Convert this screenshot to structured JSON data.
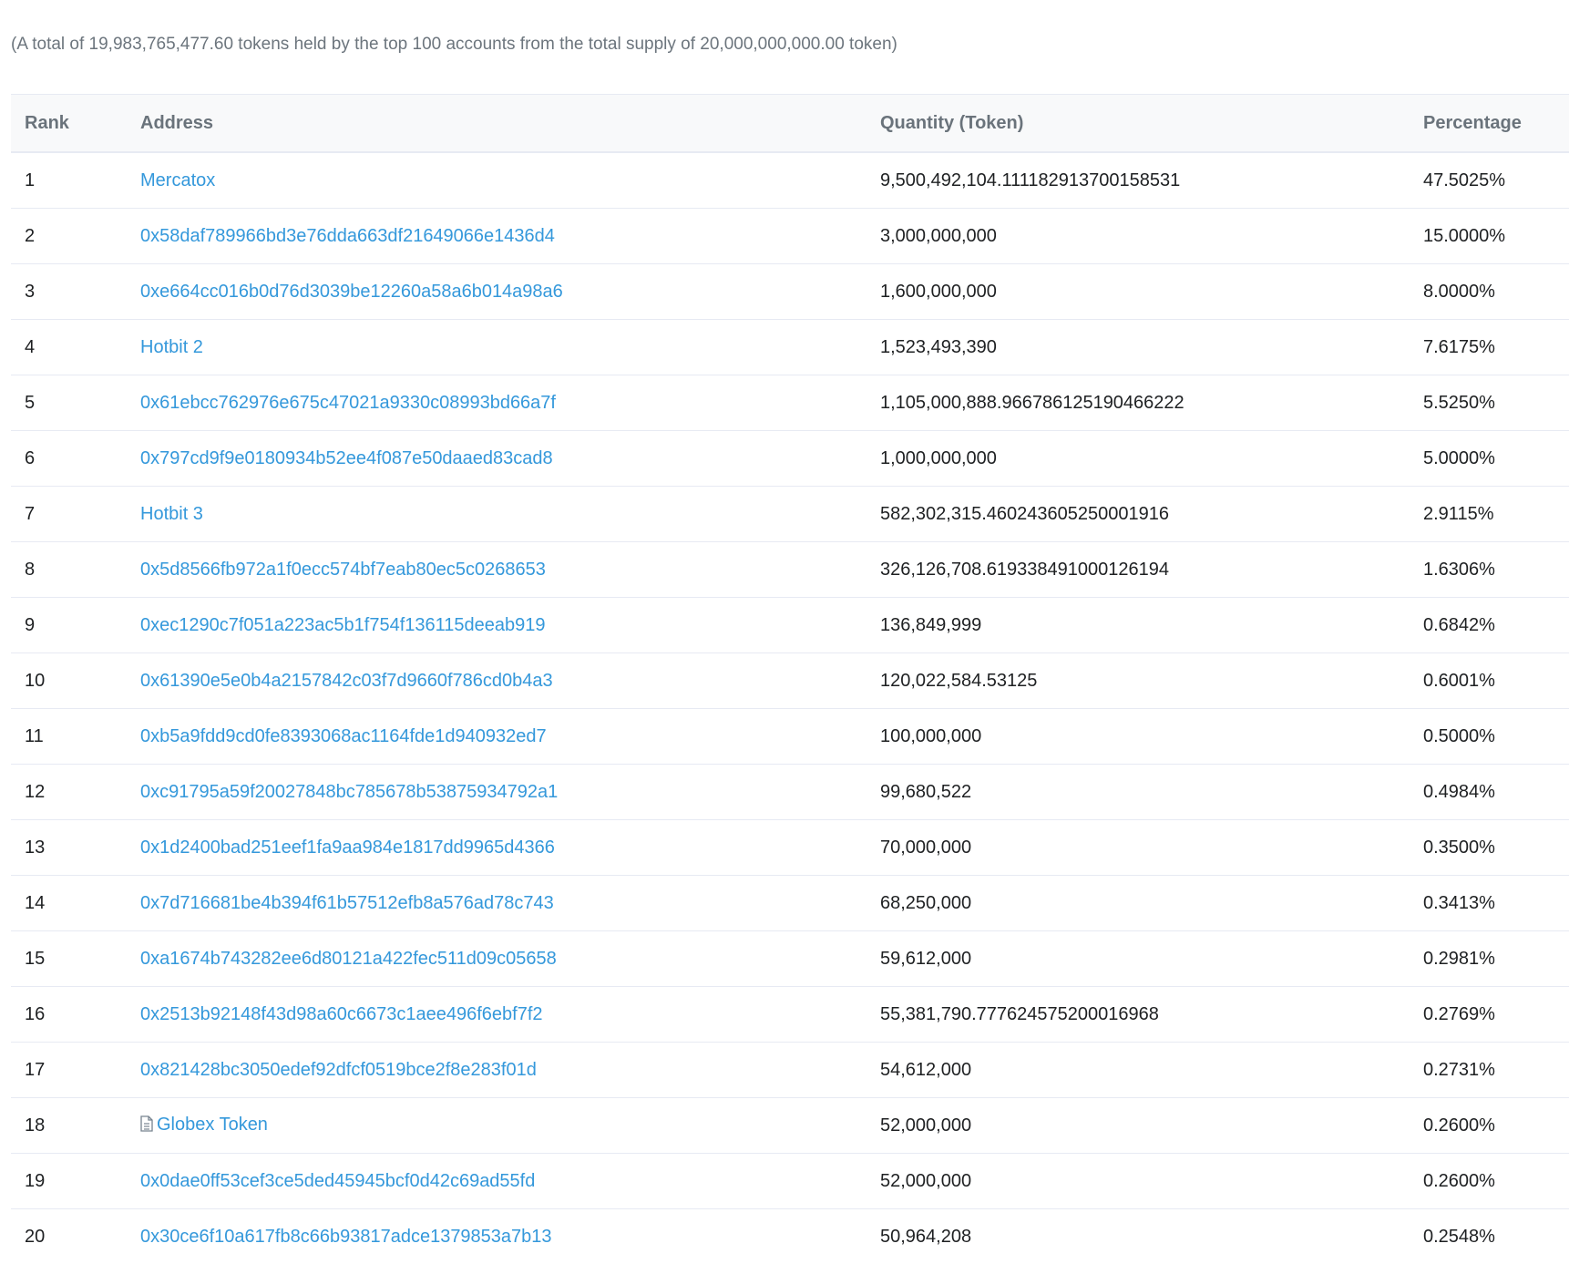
{
  "summary": "(A total of 19,983,765,477.60 tokens held by the top 100 accounts from the total supply of 20,000,000,000.00 token)",
  "table": {
    "headers": {
      "rank": "Rank",
      "address": "Address",
      "quantity": "Quantity (Token)",
      "percentage": "Percentage"
    },
    "rows": [
      {
        "rank": "1",
        "address": "Mercatox",
        "quantity": "9,500,492,104.111182913700158531",
        "percentage": "47.5025%",
        "icon": ""
      },
      {
        "rank": "2",
        "address": "0x58daf789966bd3e76dda663df21649066e1436d4",
        "quantity": "3,000,000,000",
        "percentage": "15.0000%",
        "icon": ""
      },
      {
        "rank": "3",
        "address": "0xe664cc016b0d76d3039be12260a58a6b014a98a6",
        "quantity": "1,600,000,000",
        "percentage": "8.0000%",
        "icon": ""
      },
      {
        "rank": "4",
        "address": "Hotbit 2",
        "quantity": "1,523,493,390",
        "percentage": "7.6175%",
        "icon": ""
      },
      {
        "rank": "5",
        "address": "0x61ebcc762976e675c47021a9330c08993bd66a7f",
        "quantity": "1,105,000,888.966786125190466222",
        "percentage": "5.5250%",
        "icon": ""
      },
      {
        "rank": "6",
        "address": "0x797cd9f9e0180934b52ee4f087e50daaed83cad8",
        "quantity": "1,000,000,000",
        "percentage": "5.0000%",
        "icon": ""
      },
      {
        "rank": "7",
        "address": "Hotbit 3",
        "quantity": "582,302,315.460243605250001916",
        "percentage": "2.9115%",
        "icon": ""
      },
      {
        "rank": "8",
        "address": "0x5d8566fb972a1f0ecc574bf7eab80ec5c0268653",
        "quantity": "326,126,708.619338491000126194",
        "percentage": "1.6306%",
        "icon": ""
      },
      {
        "rank": "9",
        "address": "0xec1290c7f051a223ac5b1f754f136115deeab919",
        "quantity": "136,849,999",
        "percentage": "0.6842%",
        "icon": ""
      },
      {
        "rank": "10",
        "address": "0x61390e5e0b4a2157842c03f7d9660f786cd0b4a3",
        "quantity": "120,022,584.53125",
        "percentage": "0.6001%",
        "icon": ""
      },
      {
        "rank": "11",
        "address": "0xb5a9fdd9cd0fe8393068ac1164fde1d940932ed7",
        "quantity": "100,000,000",
        "percentage": "0.5000%",
        "icon": ""
      },
      {
        "rank": "12",
        "address": "0xc91795a59f20027848bc785678b53875934792a1",
        "quantity": "99,680,522",
        "percentage": "0.4984%",
        "icon": ""
      },
      {
        "rank": "13",
        "address": "0x1d2400bad251eef1fa9aa984e1817dd9965d4366",
        "quantity": "70,000,000",
        "percentage": "0.3500%",
        "icon": ""
      },
      {
        "rank": "14",
        "address": "0x7d716681be4b394f61b57512efb8a576ad78c743",
        "quantity": "68,250,000",
        "percentage": "0.3413%",
        "icon": ""
      },
      {
        "rank": "15",
        "address": "0xa1674b743282ee6d80121a422fec511d09c05658",
        "quantity": "59,612,000",
        "percentage": "0.2981%",
        "icon": ""
      },
      {
        "rank": "16",
        "address": "0x2513b92148f43d98a60c6673c1aee496f6ebf7f2",
        "quantity": "55,381,790.777624575200016968",
        "percentage": "0.2769%",
        "icon": ""
      },
      {
        "rank": "17",
        "address": "0x821428bc3050edef92dfcf0519bce2f8e283f01d",
        "quantity": "54,612,000",
        "percentage": "0.2731%",
        "icon": ""
      },
      {
        "rank": "18",
        "address": "Globex Token",
        "quantity": "52,000,000",
        "percentage": "0.2600%",
        "icon": "contract-file-icon"
      },
      {
        "rank": "19",
        "address": "0x0dae0ff53cef3ce5ded45945bcf0d42c69ad55fd",
        "quantity": "52,000,000",
        "percentage": "0.2600%",
        "icon": ""
      },
      {
        "rank": "20",
        "address": "0x30ce6f10a617fb8c66b93817adce1379853a7b13",
        "quantity": "50,964,208",
        "percentage": "0.2548%",
        "icon": ""
      }
    ]
  },
  "colors": {
    "link": "#3498db",
    "text": "#1e2022",
    "muted": "#6c757d",
    "header_bg": "#f8f9fa",
    "border": "#e7eaf3"
  }
}
